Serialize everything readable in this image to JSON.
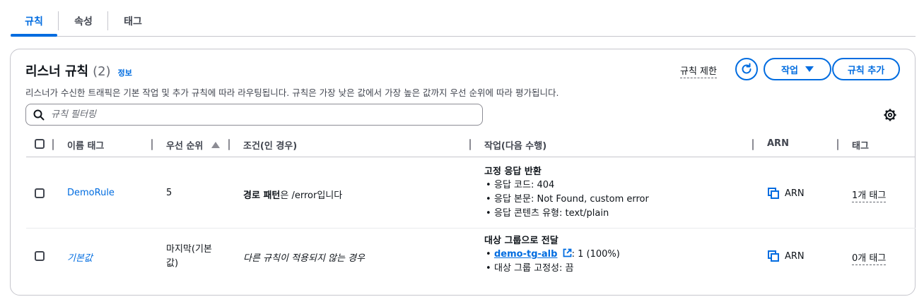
{
  "tabs": [
    {
      "label": "규칙",
      "active": true
    },
    {
      "label": "속성",
      "active": false
    },
    {
      "label": "태그",
      "active": false
    }
  ],
  "panel": {
    "title": "리스너 규칙",
    "count": "(2)",
    "info_link": "정보",
    "description": "리스너가 수신한 트래픽은 기본 작업 및 추가 규칙에 따라 라우팅됩니다. 규칙은 가장 낮은 값에서 가장 높은 값까지 우선 순위에 따라 평가됩니다.",
    "limit_link": "규칙 제한",
    "action_button": "작업",
    "add_button": "규칙 추가",
    "filter_placeholder": "규칙 필터링"
  },
  "columns": {
    "name_tag": "이름 태그",
    "priority": "우선 순위",
    "condition": "조건(인 경우)",
    "action": "작업(다음 수행)",
    "arn": "ARN",
    "tags": "태그"
  },
  "rows": [
    {
      "name": "DemoRule",
      "priority": "5",
      "condition_bold": "경로 패턴",
      "condition_rest": "은 /error입니다",
      "action_title": "고정 응답 반환",
      "action_items": [
        "응답 코드: 404",
        "응답 본문: Not Found, custom error",
        "응답 콘텐츠 유형: text/plain"
      ],
      "arn": "ARN",
      "tags": "1개 태그"
    },
    {
      "name": "기본값",
      "priority_line1": "마지막(기본",
      "priority_line2": "값)",
      "condition": "다른 규칙이 적용되지 않는 경우",
      "action_title": "대상 그룹으로 전달",
      "action_link": "demo-tg-alb",
      "action_link_suffix": ": 1 (100%)",
      "action_item2": "대상 그룹 고정성: 끔",
      "arn": "ARN",
      "tags": "0개 태그"
    }
  ],
  "colors": {
    "accent": "#006ce0",
    "text": "#0f141a",
    "muted": "#424650",
    "border": "#c6c6cd"
  }
}
